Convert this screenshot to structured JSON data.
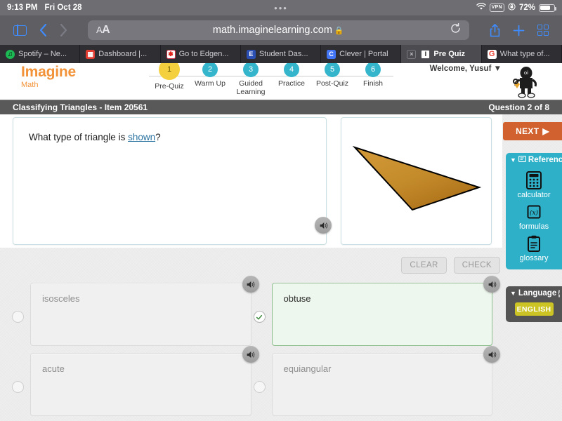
{
  "statusbar": {
    "time": "9:13 PM",
    "date": "Fri Oct 28",
    "center_dots": "•••",
    "wifi_icon": "wifi-icon",
    "vpn_label": "VPN",
    "lock_icon": "rotation-lock-icon",
    "battery_percent": "72%"
  },
  "toolbar": {
    "sidebar_icon": "sidebar-icon",
    "back_icon": "chevron-left-icon",
    "forward_icon": "chevron-right-icon",
    "aa_label": "A",
    "aa_label_big": "A",
    "url": "math.imaginelearning.com",
    "lock_icon": "lock-icon",
    "reload_icon": "reload-icon",
    "share_icon": "share-icon",
    "newtab_icon": "plus-icon",
    "tabs_icon": "tab-overview-icon"
  },
  "tabs": [
    {
      "label": "Spotify – Ne...",
      "favicon": "spotify",
      "active": false,
      "closable": false
    },
    {
      "label": "Dashboard |...",
      "favicon": "dashboard",
      "active": false,
      "closable": false
    },
    {
      "label": "Go to Edgen...",
      "favicon": "edgenuity",
      "active": false,
      "closable": false
    },
    {
      "label": "Student Das...",
      "favicon": "studentdas",
      "active": false,
      "closable": false
    },
    {
      "label": "Clever | Portal",
      "favicon": "clever",
      "active": false,
      "closable": false
    },
    {
      "label": "Pre Quiz",
      "favicon": "prequiz",
      "active": true,
      "closable": true,
      "close_label": "×"
    },
    {
      "label": "What type of...",
      "favicon": "google",
      "active": false,
      "closable": false
    }
  ],
  "app": {
    "logo_main": "Imagine",
    "logo_sub": "Math",
    "welcome": "Welcome, Yusuf",
    "welcome_caret": "▼",
    "mascot": "mascot-character",
    "steps": [
      {
        "num": "1",
        "title": "Pre-Quiz",
        "current": true
      },
      {
        "num": "2",
        "title": "Warm Up",
        "current": false
      },
      {
        "num": "3",
        "title": "Guided Learning",
        "current": false
      },
      {
        "num": "4",
        "title": "Practice",
        "current": false
      },
      {
        "num": "5",
        "title": "Post-Quiz",
        "current": false
      },
      {
        "num": "6",
        "title": "Finish",
        "current": false
      }
    ]
  },
  "titlebar": {
    "title": "Classifying Triangles - Item 20561",
    "question_counter": "Question 2 of 8"
  },
  "question": {
    "text_before": "What type of triangle is ",
    "link_text": "shown",
    "text_after": "?",
    "speaker_icon": "speaker-icon"
  },
  "figure": {
    "alt": "obtuse-triangle-figure",
    "fill_from": "#c8912f",
    "fill_to": "#b5761f",
    "stroke": "#000000"
  },
  "buttons": {
    "clear": "CLEAR",
    "check": "CHECK"
  },
  "answers": [
    {
      "label": "isosceles",
      "selected": false,
      "speaker_icon": "speaker-icon"
    },
    {
      "label": "obtuse",
      "selected": true,
      "speaker_icon": "speaker-icon"
    },
    {
      "label": "acute",
      "selected": false,
      "speaker_icon": "speaker-icon"
    },
    {
      "label": "equiangular",
      "selected": false,
      "speaker_icon": "speaker-icon"
    }
  ],
  "rail": {
    "next_label": "NEXT",
    "next_arrow": "▶",
    "reference": {
      "caret": "▼",
      "title": "Reference",
      "title_icon": "reference-icon",
      "tools": [
        {
          "label": "calculator",
          "icon": "calculator-icon"
        },
        {
          "label": "formulas",
          "icon": "formulas-icon"
        },
        {
          "label": "glossary",
          "icon": "glossary-icon"
        }
      ]
    },
    "language": {
      "caret": "▼",
      "title": "Language",
      "info_icon": "info-icon",
      "info_glyph": "i",
      "current": "ENGLISH"
    }
  },
  "colors": {
    "accent_orange": "#f29339",
    "next_orange": "#d1622f",
    "reference_teal": "#2eb0c8",
    "language_gray": "#545454",
    "english_yellow": "#ccc425",
    "selected_green": "#8dbd8d",
    "step_teal": "#35b5cc",
    "step_current_yellow": "#f4d03f"
  }
}
